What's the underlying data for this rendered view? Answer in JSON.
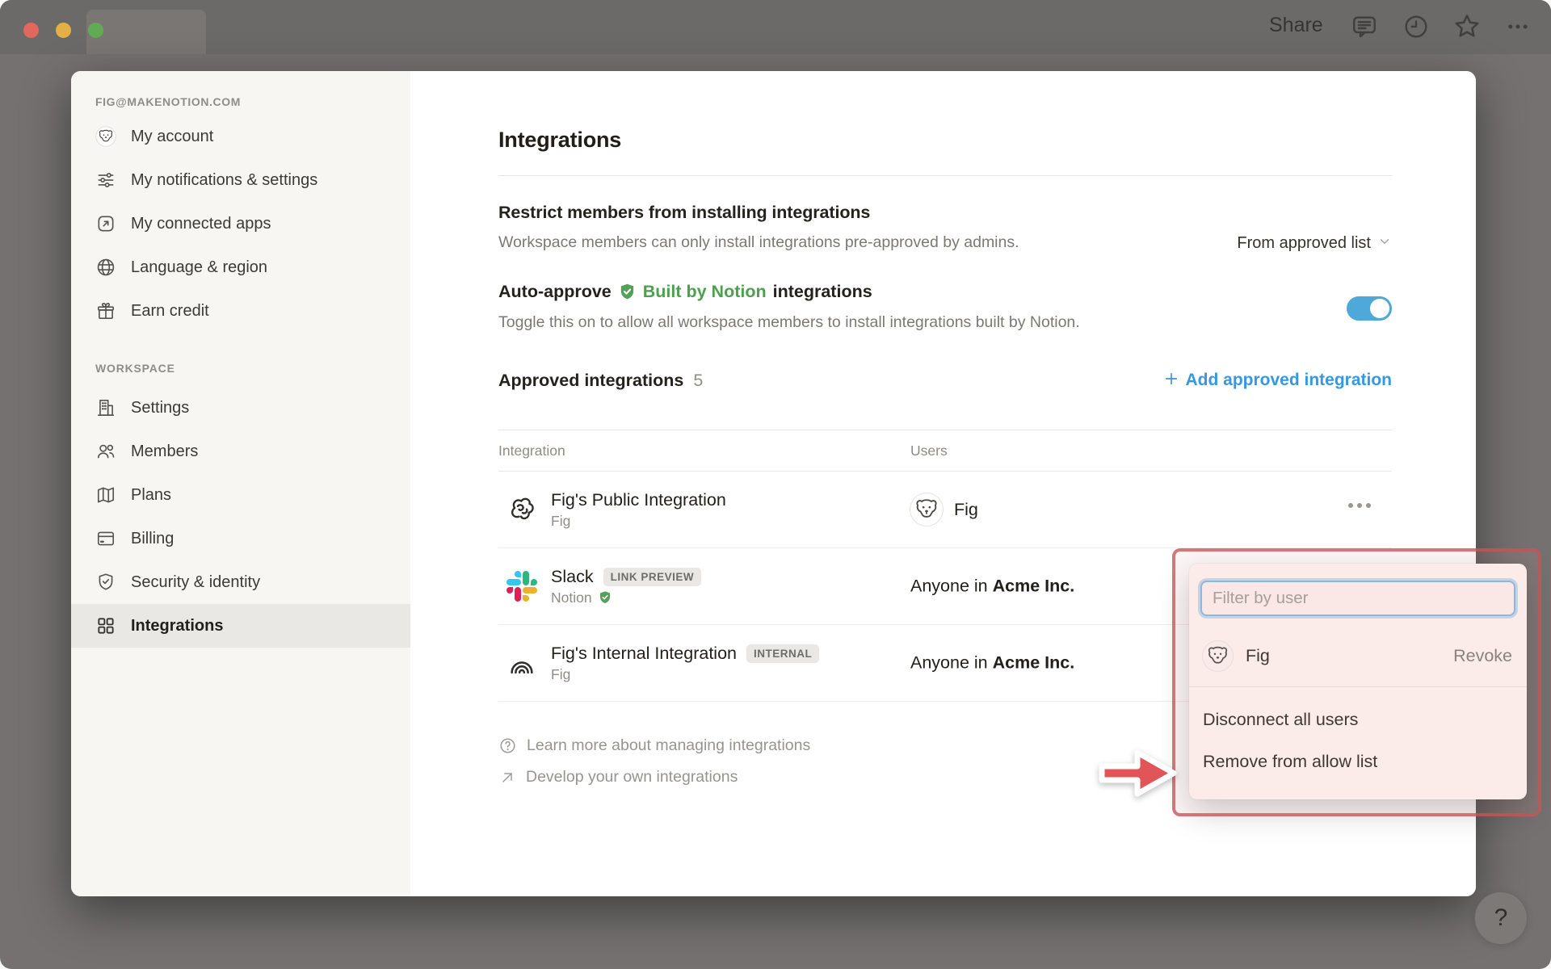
{
  "chrome": {
    "share_label": "Share"
  },
  "sidebar": {
    "account_heading": "FIG@MAKENOTION.COM",
    "items": [
      {
        "label": "My account"
      },
      {
        "label": "My notifications & settings"
      },
      {
        "label": "My connected apps"
      },
      {
        "label": "Language & region"
      },
      {
        "label": "Earn credit"
      }
    ],
    "workspace_heading": "WORKSPACE",
    "workspace_items": [
      {
        "label": "Settings"
      },
      {
        "label": "Members"
      },
      {
        "label": "Plans"
      },
      {
        "label": "Billing"
      },
      {
        "label": "Security & identity"
      },
      {
        "label": "Integrations"
      }
    ],
    "selected_item": "Integrations"
  },
  "main": {
    "title": "Integrations",
    "restrict": {
      "heading": "Restrict members from installing integrations",
      "description": "Workspace members can only install integrations pre-approved by admins.",
      "dropdown_value": "From approved list"
    },
    "auto_approve": {
      "prefix": "Auto-approve",
      "badge_text": "Built by Notion",
      "suffix": "integrations",
      "description": "Toggle this on to allow all workspace members to install integrations built by Notion.",
      "state": "on"
    },
    "approved": {
      "heading": "Approved integrations",
      "count": "5",
      "add_label": "Add approved integration"
    },
    "table": {
      "columns": [
        {
          "label": "Integration"
        },
        {
          "label": "Users"
        }
      ],
      "rows": [
        {
          "name": "Fig's Public Integration",
          "owner": "Fig",
          "users_text": "Fig"
        },
        {
          "name": "Slack",
          "badge": "LINK PREVIEW",
          "owner": "Notion",
          "verified": true,
          "users_prefix": "Anyone in",
          "users_org": "Acme Inc."
        },
        {
          "name": "Fig's Internal Integration",
          "badge": "INTERNAL",
          "owner": "Fig",
          "users_prefix": "Anyone in",
          "users_org": "Acme Inc."
        }
      ]
    },
    "footer": {
      "links": [
        {
          "label": "Learn more about managing integrations"
        },
        {
          "label": "Develop your own integrations"
        }
      ]
    }
  },
  "popup": {
    "filter_placeholder": "Filter by user",
    "user_name": "Fig",
    "revoke_label": "Revoke",
    "menu": [
      {
        "label": "Disconnect all users"
      },
      {
        "label": "Remove from allow list"
      }
    ]
  },
  "help": {
    "label": "?"
  },
  "colors": {
    "accent_blue": "#3598e2",
    "toggle_on_blue": "#4fa8da",
    "verified_green": "#55a058",
    "built_by_notion_green": "#4da04e",
    "annotation_red": "#c45456",
    "focus_ring_blue": "#85b9e0"
  }
}
